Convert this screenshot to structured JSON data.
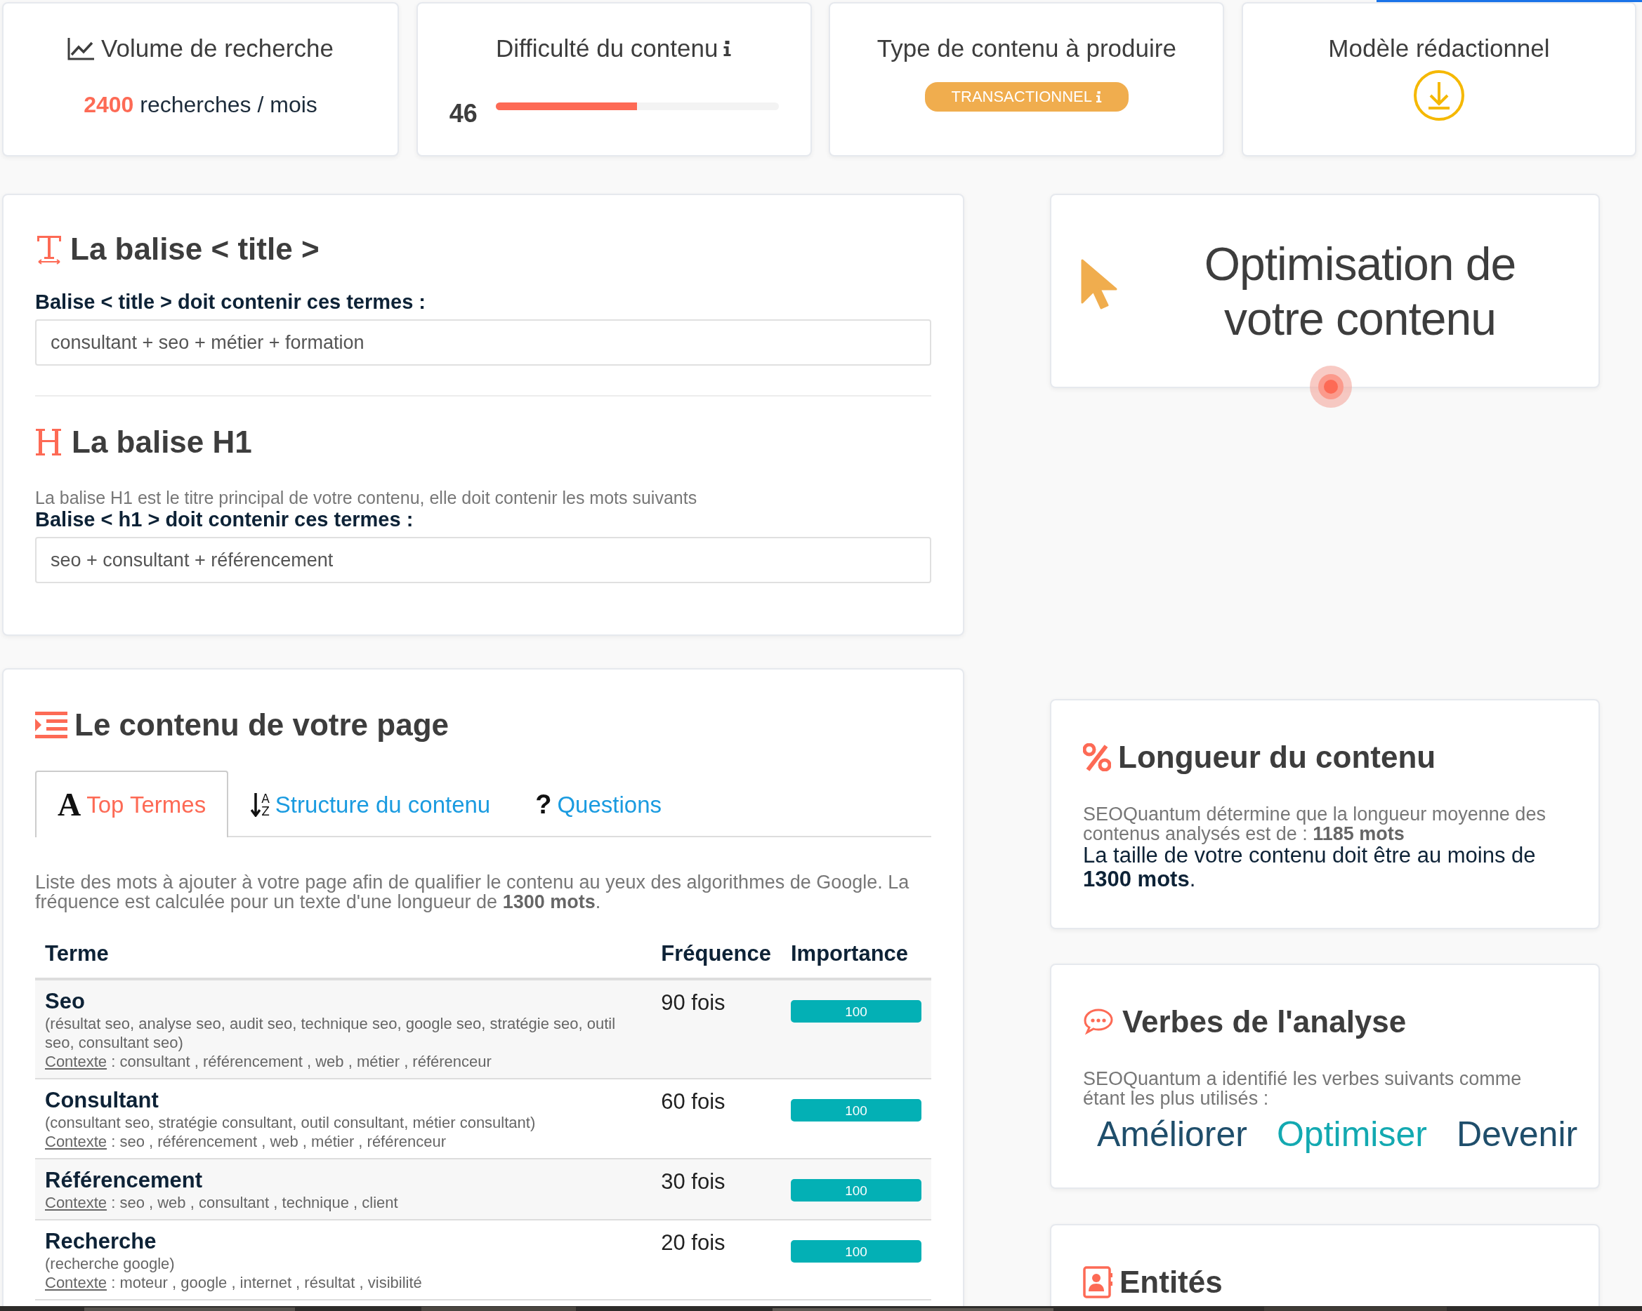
{
  "stats": [
    {
      "kind": "volume",
      "title": "Volume de recherche",
      "value": "2400",
      "unit": "recherches / mois"
    },
    {
      "kind": "difficulty",
      "title": "Difficulté du contenu",
      "value": "46",
      "level": 0.5
    },
    {
      "kind": "type",
      "title": "Type de contenu à produire",
      "badge": "TRANSACTIONNEL"
    },
    {
      "kind": "model",
      "title": "Modèle rédactionnel"
    }
  ],
  "title_tag": {
    "heading": "La balise < title >",
    "label": "Balise < title > doit contenir ces termes :",
    "value": "consultant + seo + métier + formation"
  },
  "h1_tag": {
    "heading": "La balise H1",
    "description": "La balise H1 est le titre principal de votre contenu, elle doit contenir les mots suivants",
    "label": "Balise < h1 > doit contenir ces termes :",
    "value": "seo + consultant + référencement"
  },
  "content": {
    "heading": "Le contenu de votre page",
    "tabs": [
      {
        "kind": "letter",
        "icon": "A",
        "label": "Top Termes",
        "selected": true
      },
      {
        "kind": "sort",
        "icon": "A Z",
        "label": "Structure du contenu",
        "selected": false
      },
      {
        "kind": "letter",
        "icon": "?",
        "label": "Questions",
        "selected": false
      }
    ],
    "intro": "Liste des mots à ajouter à votre page afin de qualifier le contenu au yeux des algorithmes de Google. La fréquence est calculée pour un texte d'une longueur de **1300 mots**.",
    "table": {
      "columns": [
        "Terme",
        "Fréquence",
        "Importance"
      ],
      "rows": [
        {
          "term": "Seo",
          "variants": "(résultat seo, analyse seo, audit seo, technique seo, google seo, stratégie seo, outil seo, consultant seo)",
          "context_label": "Contexte",
          "context": " : consultant , référencement , web , métier , référenceur",
          "frequency": "90 fois",
          "importance": "100"
        },
        {
          "term": "Consultant",
          "variants": "(consultant seo, stratégie consultant, outil consultant, métier consultant)",
          "context_label": "Contexte",
          "context": " : seo , référencement , web , métier , référenceur",
          "frequency": "60 fois",
          "importance": "100"
        },
        {
          "term": "Référencement",
          "context_label": "Contexte",
          "context": " : seo , web , consultant , technique , client",
          "frequency": "30 fois",
          "importance": "100"
        },
        {
          "term": "Recherche",
          "variants": "(recherche google)",
          "context_label": "Contexte",
          "context": " : moteur , google , internet , résultat , visibilité",
          "frequency": "20 fois",
          "importance": "100"
        }
      ]
    }
  },
  "optimisation": {
    "title": "Optimisation de votre contenu"
  },
  "length": {
    "heading": "Longueur du contenu",
    "analysis": "SEOQuantum détermine que la longueur moyenne des contenus analysés est de : **1185 mots**",
    "requirement": "La taille de votre contenu doit être au moins de **1300 mots**."
  },
  "verbs": {
    "heading": "Verbes de l'analyse",
    "intro": "SEOQuantum a identifié les verbes suivants comme étant les plus utilisés :",
    "items": [
      {
        "label": "Améliorer",
        "color": "#1f4e6b"
      },
      {
        "label": "Optimiser",
        "color": "#13a9b1"
      },
      {
        "label": "Devenir",
        "color": "#1f4e6b"
      }
    ]
  },
  "entities": {
    "heading": "Entités"
  }
}
